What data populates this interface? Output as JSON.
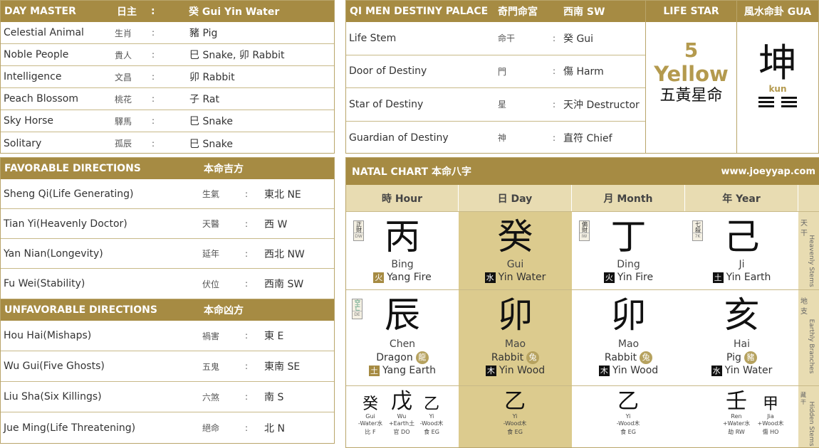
{
  "day_master": {
    "title": "DAY MASTER",
    "title_cn": "日主",
    "colon": ":",
    "value": "癸 Gui Yin Water",
    "rows": [
      {
        "label": "Celestial Animal",
        "cn": "生肖",
        "value": "豬 Pig"
      },
      {
        "label": "Noble People",
        "cn": "貴人",
        "value": "巳 Snake, 卯 Rabbit"
      },
      {
        "label": "Intelligence",
        "cn": "文昌",
        "value": "卯 Rabbit"
      },
      {
        "label": "Peach Blossom",
        "cn": "桃花",
        "value": "子 Rat"
      },
      {
        "label": "Sky Horse",
        "cn": "驛馬",
        "value": "巳 Snake"
      },
      {
        "label": "Solitary",
        "cn": "孤辰",
        "value": "巳 Snake"
      }
    ]
  },
  "qimen": {
    "title": "QI MEN DESTINY PALACE",
    "title_cn": "奇門命宮",
    "title_value": "西南 SW",
    "rows": [
      {
        "label": "Life Stem",
        "cn": "命干",
        "value": "癸 Gui"
      },
      {
        "label": "Door of Destiny",
        "cn": "門",
        "value": "傷 Harm"
      },
      {
        "label": "Star of Destiny",
        "cn": "星",
        "value": "天沖 Destructor"
      },
      {
        "label": "Guardian of Destiny",
        "cn": "神",
        "value": "直符 Chief"
      }
    ]
  },
  "life_star": {
    "title": "LIFE STAR",
    "number": "5",
    "name": "Yellow",
    "cn": "五黃星命"
  },
  "gua": {
    "title": "風水命卦 GUA",
    "char": "坤",
    "pinyin": "kun"
  },
  "favorable": {
    "title": "FAVORABLE DIRECTIONS",
    "title_cn": "本命吉方",
    "rows": [
      {
        "label": "Sheng Qi(Life Generating)",
        "cn": "生氣",
        "value": "東北 NE"
      },
      {
        "label": "Tian Yi(Heavenly Doctor)",
        "cn": "天醫",
        "value": "西 W"
      },
      {
        "label": "Yan Nian(Longevity)",
        "cn": "延年",
        "value": "西北 NW"
      },
      {
        "label": "Fu Wei(Stability)",
        "cn": "伏位",
        "value": "西南 SW"
      }
    ]
  },
  "unfavorable": {
    "title": "UNFAVORABLE DIRECTIONS",
    "title_cn": "本命凶方",
    "rows": [
      {
        "label": "Hou Hai(Mishaps)",
        "cn": "禍害",
        "value": "東 E"
      },
      {
        "label": "Wu Gui(Five Ghosts)",
        "cn": "五鬼",
        "value": "東南 SE"
      },
      {
        "label": "Liu Sha(Six Killings)",
        "cn": "六煞",
        "value": "南 S"
      },
      {
        "label": "Jue Ming(Life Threatening)",
        "cn": "絕命",
        "value": "北 N"
      }
    ]
  },
  "natal": {
    "title": "NATAL CHART 本命八字",
    "website": "www.joeyyap.com",
    "columns": [
      {
        "header": "時 Hour",
        "stem": {
          "char": "丙",
          "pinyin": "Bing",
          "elem_char": "火",
          "elem": "Yang Fire",
          "tag": "正財",
          "tag_code": "DW"
        },
        "branch": {
          "char": "辰",
          "pinyin": "Chen",
          "animal": "Dragon",
          "animal_char": "龍",
          "elem_char": "土",
          "elem": "Yang Earth",
          "tag": "空亡",
          "tag_code": "DE"
        },
        "hidden": [
          {
            "char": "癸",
            "pinyin": "Gui",
            "elem": "-Water水",
            "god": "比 F"
          },
          {
            "char": "戊",
            "pinyin": "Wu",
            "elem": "+Earth土",
            "god": "官 DO"
          },
          {
            "char": "乙",
            "pinyin": "Yi",
            "elem": "-Wood木",
            "god": "食 EG"
          }
        ]
      },
      {
        "header": "日 Day",
        "stem": {
          "char": "癸",
          "pinyin": "Gui",
          "elem_char": "水",
          "elem": "Yin Water",
          "tag": "",
          "tag_code": ""
        },
        "branch": {
          "char": "卯",
          "pinyin": "Mao",
          "animal": "Rabbit",
          "animal_char": "兔",
          "elem_char": "木",
          "elem": "Yin Wood",
          "tag": "",
          "tag_code": ""
        },
        "hidden": [
          {
            "char": "乙",
            "pinyin": "Yi",
            "elem": "-Wood木",
            "god": "食 EG"
          }
        ]
      },
      {
        "header": "月 Month",
        "stem": {
          "char": "丁",
          "pinyin": "Ding",
          "elem_char": "火",
          "elem": "Yin Fire",
          "tag": "偏財",
          "tag_code": "IW"
        },
        "branch": {
          "char": "卯",
          "pinyin": "Mao",
          "animal": "Rabbit",
          "animal_char": "兔",
          "elem_char": "木",
          "elem": "Yin Wood",
          "tag": "",
          "tag_code": ""
        },
        "hidden": [
          {
            "char": "乙",
            "pinyin": "Yi",
            "elem": "-Wood木",
            "god": "食 EG"
          }
        ]
      },
      {
        "header": "年 Year",
        "stem": {
          "char": "己",
          "pinyin": "Ji",
          "elem_char": "土",
          "elem": "Yin Earth",
          "tag": "七殺",
          "tag_code": "7K"
        },
        "branch": {
          "char": "亥",
          "pinyin": "Hai",
          "animal": "Pig",
          "animal_char": "豬",
          "elem_char": "水",
          "elem": "Yin Water",
          "tag": "",
          "tag_code": ""
        },
        "hidden": [
          {
            "char": "壬",
            "pinyin": "Ren",
            "elem": "+Water水",
            "god": "劫 RW"
          },
          {
            "char": "甲",
            "pinyin": "Jia",
            "elem": "+Wood木",
            "god": "傷 HO"
          }
        ]
      }
    ],
    "side_labels": {
      "stems_cn": "天干",
      "stems": "Heavenly Stems",
      "branches_cn": "地支",
      "branches": "Earthly Branches",
      "hidden_cn": "藏干",
      "hidden": "Hidden Stems"
    }
  },
  "colors": {
    "gold": "#a68b43",
    "gold_light": "#dccb8e",
    "gold_header": "#e8dcb2",
    "star_gold": "#b49a4e"
  }
}
